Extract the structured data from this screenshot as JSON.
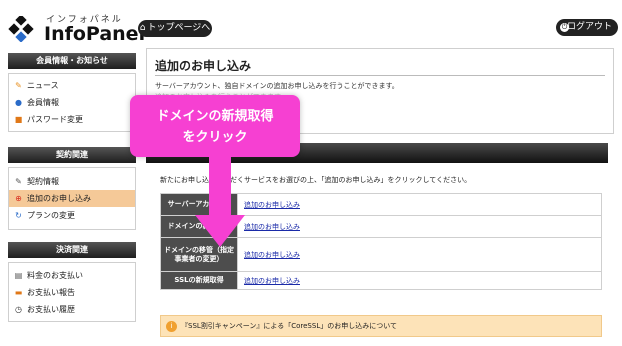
{
  "header": {
    "logo_kana": "インフォパネル",
    "logo_brand": "InfoPanel",
    "top_button": "トップページへ",
    "logout_button": "ログアウト"
  },
  "sidebar": {
    "sections": [
      {
        "title": "会員情報・お知らせ",
        "items": [
          {
            "label": "ニュース",
            "icon": "news-icon"
          },
          {
            "label": "会員情報",
            "icon": "user-icon"
          },
          {
            "label": "パスワード変更",
            "icon": "lock-icon"
          }
        ]
      },
      {
        "title": "契約関連",
        "items": [
          {
            "label": "契約情報",
            "icon": "contract-icon"
          },
          {
            "label": "追加のお申し込み",
            "icon": "add-icon"
          },
          {
            "label": "プランの変更",
            "icon": "change-icon"
          }
        ]
      },
      {
        "title": "決済関連",
        "items": [
          {
            "label": "料金のお支払い",
            "icon": "payment-icon"
          },
          {
            "label": "お支払い報告",
            "icon": "report-icon"
          },
          {
            "label": "お支払い履歴",
            "icon": "history-icon"
          }
        ]
      }
    ]
  },
  "main": {
    "title": "追加のお申し込み",
    "description": "サーバーアカウント、独自ドメインの追加お申し込みを行うことができます。",
    "description2": "追加のお申し込みを行うことができます。",
    "instruction": "新たにお申し込みいただくサービスをお選びの上、「追加のお申し込み」をクリックしてください。",
    "table": [
      {
        "service": "サーバーアカウント",
        "action": "追加のお申し込み"
      },
      {
        "service": "ドメインの新規取得",
        "action": "追加のお申し込み"
      },
      {
        "service": "ドメインの移管（指定事業者の変更）",
        "action": "追加のお申し込み"
      },
      {
        "service": "SSLの新規取得",
        "action": "追加のお申し込み"
      }
    ],
    "campaign": "『SSL割引キャンペーン』による「CoreSSL」のお申し込みについて"
  },
  "annotation": {
    "line1": "ドメインの新規取得",
    "line2": "をクリック",
    "color": "#f640d2"
  }
}
